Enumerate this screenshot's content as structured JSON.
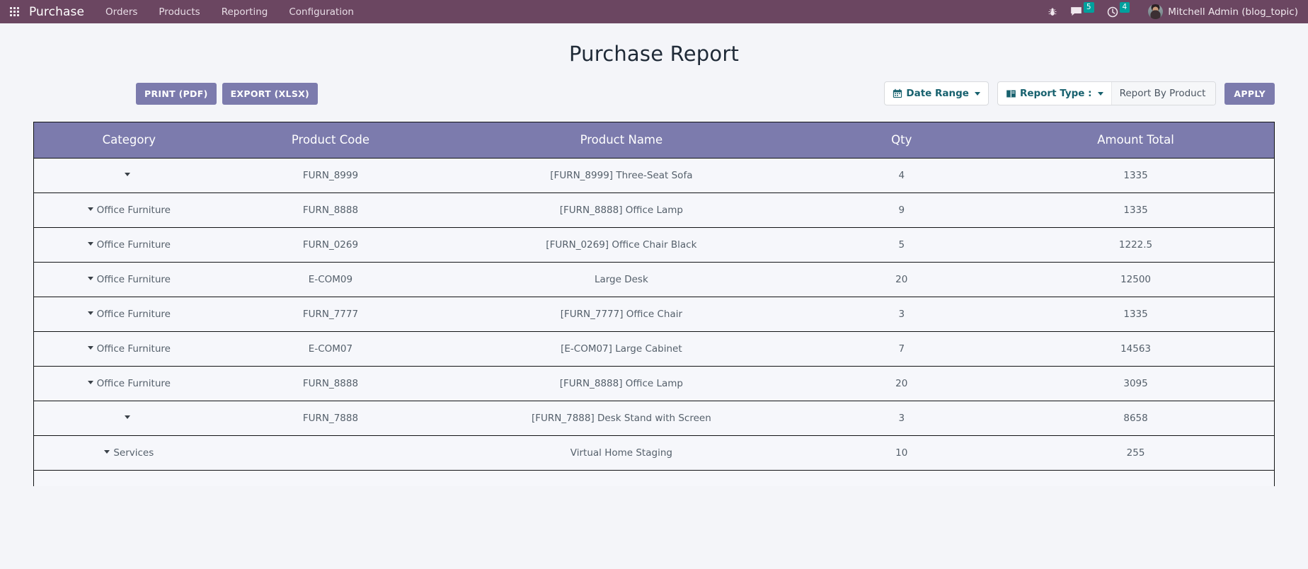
{
  "topnav": {
    "apps_icon": "apps-grid-icon",
    "brand": "Purchase",
    "menu": [
      {
        "label": "Orders"
      },
      {
        "label": "Products"
      },
      {
        "label": "Reporting"
      },
      {
        "label": "Configuration"
      }
    ],
    "right": {
      "bug_icon": "bug-icon",
      "messages_icon": "chat-bubble-icon",
      "messages_count": "5",
      "activities_icon": "clock-icon",
      "activities_count": "4",
      "avatar": "user-avatar",
      "username": "Mitchell Admin (blog_topic)"
    }
  },
  "page": {
    "title": "Purchase Report"
  },
  "toolbar": {
    "print_pdf_label": "PRINT (PDF)",
    "export_xlsx_label": "EXPORT (XLSX)",
    "date_range_label": "Date Range",
    "date_range_icon": "calendar-icon",
    "report_type_label": "Report Type :",
    "report_type_icon": "book-icon",
    "report_type_value": "Report By Product",
    "apply_label": "APPLY"
  },
  "table": {
    "columns": [
      {
        "label": "Category"
      },
      {
        "label": "Product Code"
      },
      {
        "label": "Product Name"
      },
      {
        "label": "Qty"
      },
      {
        "label": "Amount Total"
      }
    ],
    "rows": [
      {
        "category": "",
        "code": "FURN_8999",
        "name": "[FURN_8999] Three-Seat Sofa",
        "qty": "4",
        "amount": "1335"
      },
      {
        "category": "Office Furniture",
        "code": "FURN_8888",
        "name": "[FURN_8888] Office Lamp",
        "qty": "9",
        "amount": "1335"
      },
      {
        "category": "Office Furniture",
        "code": "FURN_0269",
        "name": "[FURN_0269] Office Chair Black",
        "qty": "5",
        "amount": "1222.5"
      },
      {
        "category": "Office Furniture",
        "code": "E-COM09",
        "name": "Large Desk",
        "qty": "20",
        "amount": "12500"
      },
      {
        "category": "Office Furniture",
        "code": "FURN_7777",
        "name": "[FURN_7777] Office Chair",
        "qty": "3",
        "amount": "1335"
      },
      {
        "category": "Office Furniture",
        "code": "E-COM07",
        "name": "[E-COM07] Large Cabinet",
        "qty": "7",
        "amount": "14563"
      },
      {
        "category": "Office Furniture",
        "code": "FURN_8888",
        "name": "[FURN_8888] Office Lamp",
        "qty": "20",
        "amount": "3095"
      },
      {
        "category": "",
        "code": "FURN_7888",
        "name": "[FURN_7888] Desk Stand with Screen",
        "qty": "3",
        "amount": "8658"
      },
      {
        "category": "Services",
        "code": "",
        "name": "Virtual Home Staging",
        "qty": "10",
        "amount": "255"
      }
    ]
  },
  "colors": {
    "navbar": "#6b4661",
    "accent_purple": "#7c7bad",
    "badge_teal": "#00a09d",
    "page_bg": "#f4f5f9",
    "link_teal": "#17616e"
  }
}
